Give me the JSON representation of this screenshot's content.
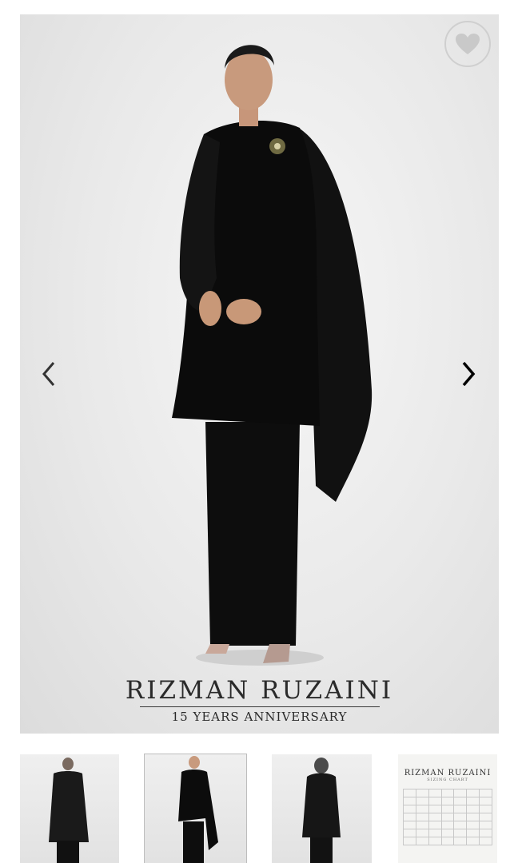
{
  "main_image": {
    "brand_name": "RIZMAN RUZAINI",
    "brand_subtitle": "15 YEARS ANNIVERSARY",
    "favorite_icon": "heart-icon",
    "prev_icon": "chevron-left-icon",
    "next_icon": "chevron-right-icon"
  },
  "thumbnails": [
    {
      "kind": "model-back"
    },
    {
      "kind": "model-front",
      "active": true
    },
    {
      "kind": "model-hijab"
    },
    {
      "kind": "sizing-chart",
      "title": "RIZMAN RUZAINI",
      "subtitle": "SIZING CHART"
    }
  ],
  "colors": {
    "garment": "#0d0d0d",
    "background": "#e8e8e8",
    "accent": "#000000"
  }
}
